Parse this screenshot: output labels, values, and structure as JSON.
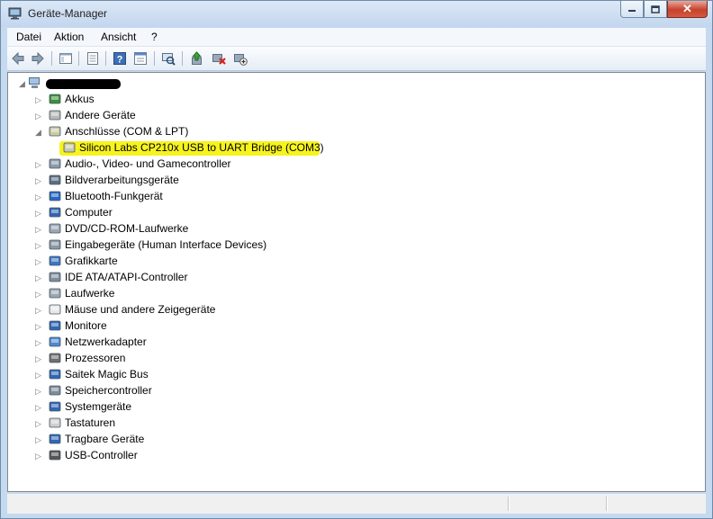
{
  "window": {
    "title": "Geräte-Manager",
    "close_glyph": "✕"
  },
  "menu": [
    "Datei",
    "Aktion",
    "Ansicht",
    "?"
  ],
  "toolbar": [
    "back-icon",
    "forward-icon",
    "show-hide-tree-icon",
    "properties-icon",
    "help-icon",
    "properties-sheet-icon",
    "scan-hardware-icon",
    "update-driver-icon",
    "uninstall-icon",
    "disable-icon"
  ],
  "tree": {
    "root_label": "",
    "items": [
      {
        "label": "Akkus",
        "icon": "battery-icon"
      },
      {
        "label": "Andere Geräte",
        "icon": "unknown-device-icon"
      },
      {
        "label": "Anschlüsse (COM & LPT)",
        "icon": "port-icon",
        "expanded": true
      },
      {
        "label": "Silicon Labs CP210x USB to UART Bridge (COM3)",
        "icon": "port-icon",
        "child": true,
        "highlighted": true
      },
      {
        "label": "Audio-, Video- und Gamecontroller",
        "icon": "speaker-icon"
      },
      {
        "label": "Bildverarbeitungsgeräte",
        "icon": "camera-icon"
      },
      {
        "label": "Bluetooth-Funkgerät",
        "icon": "bluetooth-icon"
      },
      {
        "label": "Computer",
        "icon": "computer-icon"
      },
      {
        "label": "DVD/CD-ROM-Laufwerke",
        "icon": "disc-drive-icon"
      },
      {
        "label": "Eingabegeräte (Human Interface Devices)",
        "icon": "hid-icon"
      },
      {
        "label": "Grafikkarte",
        "icon": "display-adapter-icon"
      },
      {
        "label": "IDE ATA/ATAPI-Controller",
        "icon": "ide-controller-icon"
      },
      {
        "label": "Laufwerke",
        "icon": "disk-drive-icon"
      },
      {
        "label": "Mäuse und andere Zeigegeräte",
        "icon": "mouse-icon"
      },
      {
        "label": "Monitore",
        "icon": "monitor-icon"
      },
      {
        "label": "Netzwerkadapter",
        "icon": "network-adapter-icon"
      },
      {
        "label": "Prozessoren",
        "icon": "processor-icon"
      },
      {
        "label": "Saitek Magic Bus",
        "icon": "monitor-icon"
      },
      {
        "label": "Speichercontroller",
        "icon": "storage-controller-icon"
      },
      {
        "label": "Systemgeräte",
        "icon": "system-devices-icon"
      },
      {
        "label": "Tastaturen",
        "icon": "keyboard-icon"
      },
      {
        "label": "Tragbare Geräte",
        "icon": "portable-device-icon"
      },
      {
        "label": "USB-Controller",
        "icon": "usb-icon"
      }
    ]
  },
  "colors": {
    "highlight": "#f7f31f",
    "window_frame": "#c5d9ef",
    "close_button": "#c8412c"
  }
}
